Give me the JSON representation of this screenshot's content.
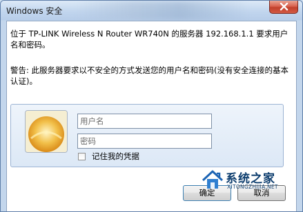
{
  "window": {
    "title": "Windows 安全"
  },
  "message": {
    "text": "位于 TP-LINK Wireless N Router WR740N 的服务器 192.168.1.1 要求用户名和密码。"
  },
  "warning": {
    "text": "警告: 此服务器要求以不安全的方式发送您的用户名和密码(没有安全连接的基本认证)。"
  },
  "credentials": {
    "username_placeholder": "用户名",
    "password_placeholder": "密码",
    "remember_label": "记住我的凭据",
    "remember_checked": false
  },
  "buttons": {
    "ok_label": "确定",
    "cancel_label": "取消"
  },
  "watermark": {
    "text": "系统之家",
    "sub": "XITONGZHIJIA.NET"
  },
  "icons": {
    "close": "close-icon",
    "avatar": "user-avatar-icon",
    "watermark_logo": "house-logo-icon"
  },
  "colors": {
    "title_bar": "#c2d6ee",
    "close_button": "#c1402c",
    "panel_bg": "#dce8f6",
    "watermark": "#0d3d6e"
  }
}
